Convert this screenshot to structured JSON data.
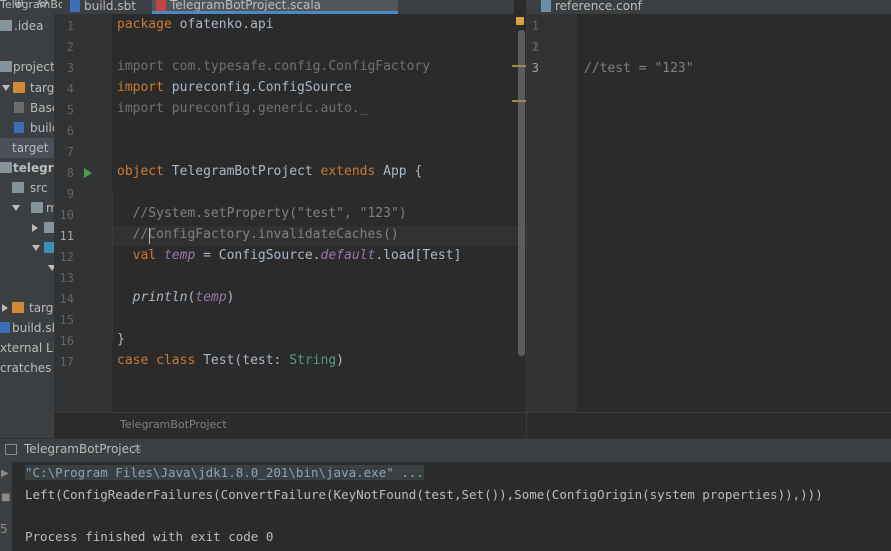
{
  "project_tree": {
    "root_label": "TelegramBo",
    "items": [
      {
        "label": ".idea"
      },
      {
        "label": "project"
      },
      {
        "label": "target"
      },
      {
        "label": "Base"
      },
      {
        "label": "build"
      },
      {
        "label": "target"
      },
      {
        "label": "telegram"
      },
      {
        "label": "src"
      },
      {
        "label": "m"
      },
      {
        "label": ""
      },
      {
        "label": ""
      },
      {
        "label": ""
      },
      {
        "label": "target"
      },
      {
        "label": "build.sb"
      },
      {
        "label": "xternal Lib"
      },
      {
        "label": "cratches a"
      }
    ]
  },
  "tabs_left": [
    {
      "label": "build.sbt"
    },
    {
      "label": "TelegramBotProject.scala"
    }
  ],
  "tabs_right": [
    {
      "label": "reference.conf"
    }
  ],
  "editor": {
    "lines": [
      {
        "n": "1"
      },
      {
        "n": "2"
      },
      {
        "n": "3"
      },
      {
        "n": "4"
      },
      {
        "n": "5"
      },
      {
        "n": "6"
      },
      {
        "n": "7"
      },
      {
        "n": "8"
      },
      {
        "n": "9"
      },
      {
        "n": "10"
      },
      {
        "n": "11"
      },
      {
        "n": "12"
      },
      {
        "n": "13"
      },
      {
        "n": "14"
      },
      {
        "n": "15"
      },
      {
        "n": "16"
      },
      {
        "n": "17"
      }
    ],
    "code": {
      "l1_kw": "package",
      "l1_rest": " ofatenko.api",
      "l3": "import com.typesafe.config.ConfigFactory",
      "l4_kw": "import",
      "l4_rest": " pureconfig.ConfigSource",
      "l5": "import pureconfig.generic.auto._",
      "l8_kw1": "object",
      "l8_name": " TelegramBotProject ",
      "l8_kw2": "extends",
      "l8_rest": " App {",
      "l10_a": "//System.setProperty(",
      "l10_s1": "\"test\"",
      "l10_b": ", ",
      "l10_s2": "\"123\"",
      "l10_c": ")",
      "l11": "//ConfigFactory.invalidateCaches()",
      "l12_kw": "val",
      "l12_v": "temp",
      "l12_a": " = ConfigSource.",
      "l12_d": "default",
      "l12_b": ".load[Test]",
      "l14_f": "println",
      "l14_a": "(",
      "l14_v": "temp",
      "l14_b": ")",
      "l16": "}",
      "l17_kw1": "case",
      "l17_kw2": "class",
      "l17_a": " Test(test: ",
      "l17_t": "String",
      "l17_b": ")"
    },
    "breadcrumb": "TelegramBotProject"
  },
  "editor2": {
    "lines": [
      {
        "n": "1"
      },
      {
        "n": "2"
      },
      {
        "n": "3"
      }
    ],
    "code_l3": "//test = \"123\""
  },
  "run": {
    "tab_label": "TelegramBotProject",
    "output": [
      "\"C:\\Program Files\\Java\\jdk1.8.0_201\\bin\\java.exe\" ...",
      "Left(ConfigReaderFailures(ConvertFailure(KeyNotFound(test,Set()),Some(ConfigOrigin(system properties)),)))",
      "",
      "Process finished with exit code 0"
    ]
  },
  "colors": {
    "keyword": "#cc7832",
    "comment": "#808080",
    "string": "#6a8759",
    "accent": "#4a88c7"
  }
}
